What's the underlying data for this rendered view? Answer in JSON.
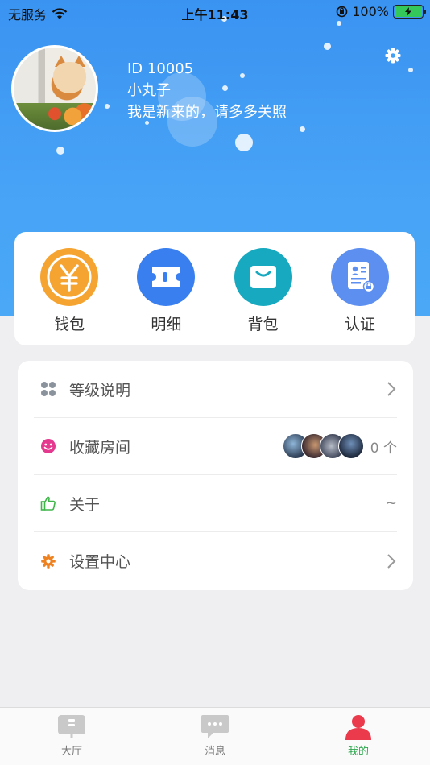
{
  "status_bar": {
    "carrier": "无服务",
    "time": "上午11:43",
    "battery_percent": "100%"
  },
  "profile": {
    "id_text": "ID 10005",
    "nickname": "小丸子",
    "signature": "我是新来的，请多多关照"
  },
  "quick_actions": [
    {
      "label": "钱包",
      "icon": "wallet-yuan-icon",
      "color": "#f5a431"
    },
    {
      "label": "明细",
      "icon": "ticket-icon",
      "color": "#3a7ff0"
    },
    {
      "label": "背包",
      "icon": "bag-icon",
      "color": "#16a9bf"
    },
    {
      "label": "认证",
      "icon": "id-card-icon",
      "color": "#5d8ff0"
    }
  ],
  "menu": [
    {
      "label": "等级说明",
      "icon": "grid-dots-icon",
      "icon_color": "#8a929c",
      "right_text": "",
      "chevron": true
    },
    {
      "label": "收藏房间",
      "icon": "smile-icon",
      "icon_color": "#e4398f",
      "right_text": "0 个",
      "chevron": false
    },
    {
      "label": "关于",
      "icon": "thumbs-up-icon",
      "icon_color": "#3fb54a",
      "right_text": "~",
      "chevron": false
    },
    {
      "label": "设置中心",
      "icon": "gear-icon",
      "icon_color": "#ee8220",
      "right_text": "",
      "chevron": true
    }
  ],
  "tabs": [
    {
      "label": "大厅",
      "icon": "lobby-icon",
      "active": false
    },
    {
      "label": "消息",
      "icon": "message-icon",
      "active": false
    },
    {
      "label": "我的",
      "icon": "person-icon",
      "active": true
    }
  ]
}
